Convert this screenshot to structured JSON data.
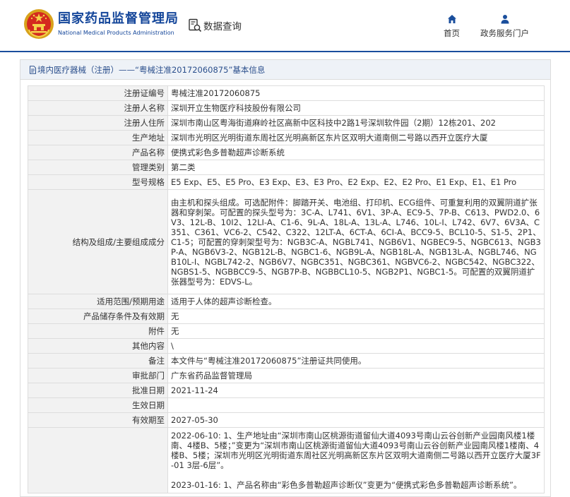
{
  "header": {
    "brand_cn": "国家药品监督管理局",
    "brand_en": "National Medical Products Administration",
    "data_query": "数据查询",
    "nav_home": "首页",
    "nav_services": "政务服务门户"
  },
  "panel": {
    "title": "境内医疗器械（注册）——“粤械注准20172060875”基本信息"
  },
  "rows": [
    {
      "label": "注册证编号",
      "value": "粤械注准20172060875"
    },
    {
      "label": "注册人名称",
      "value": "深圳开立生物医疗科技股份有限公司"
    },
    {
      "label": "注册人住所",
      "value": "深圳市南山区粤海街道麻岭社区高新中区科技中2路1号深圳软件园（2期）12栋201、202"
    },
    {
      "label": "生产地址",
      "value": "深圳市光明区光明街道东周社区光明高新区东片区双明大道南侧二号路以西开立医疗大厦"
    },
    {
      "label": "产品名称",
      "value": "便携式彩色多普勒超声诊断系统"
    },
    {
      "label": "管理类别",
      "value": "第二类"
    },
    {
      "label": "型号规格",
      "value": "E5 Exp、E5、E5 Pro、E3 Exp、E3、E3 Pro、E2 Exp、E2、E2 Pro、E1 Exp、E1、E1 Pro"
    },
    {
      "label": "结构及组成/主要组成成分",
      "value": "由主机和探头组成。可选配附件：脚踏开关、电池组、打印机、ECG组件、可重复利用的双翼阴道扩张器和穿刺架。可配置的探头型号为：3C-A、L741、6V1、3P-A、EC9-5、7P-B、C613、PWD2.0、6V3、12L-B、10I2、12LI-A、C1-6、9L-A、18L-A、13L-A、L746、10L-I、L742、6V7、6V3A、C351、C361、VC6-2、C542、C322、12LT-A、6CT-A、6CI-A、BCC9-5、BCL10-5、S1-5、2P1、C1-5；可配置的穿刺架型号为：NGB3C-A、NGBL741、NGB6V1、NGBEC9-5、NGBC613、NGB3P-A、NGB6V3-2、NGB12L-B、NGBC1-6、NGB9L-A、NGB18L-A、NGB13L-A、NGBL746、NGB10L-I、NGBL742-2、NGB6V7、NGBC351、NGBC361、NGBVC6-2、NGBC542、NGBC322、NGBS1-5、NGBBCC9-5、NGB7P-B、NGBBCL10-5、NGB2P1、NGBC1-5。可配置的双翼阴道扩张器型号为：EDVS-L。"
    },
    {
      "label": "适用范围/预期用途",
      "value": "适用于人体的超声诊断检查。"
    },
    {
      "label": "产品储存条件及有效期",
      "value": "无"
    },
    {
      "label": "附件",
      "value": "无"
    },
    {
      "label": "其他内容",
      "value": "\\"
    },
    {
      "label": "备注",
      "value": "本文件与“粤械注准20172060875”注册证共同使用。"
    },
    {
      "label": "审批部门",
      "value": "广东省药品监督管理局"
    },
    {
      "label": "批准日期",
      "value": "2021-11-24"
    },
    {
      "label": "生效日期",
      "value": ""
    },
    {
      "label": "有效期至",
      "value": "2027-05-30"
    },
    {
      "label": "",
      "value": ""
    }
  ],
  "changes": [
    "2022-06-10: 1、生产地址由“深圳市南山区桃源街道留仙大道4093号南山云谷创新产业园南风楼1楼南、4楼B、5楼；”变更为“深圳市南山区桃源街道留仙大道4093号南山云谷创新产业园南风楼1楼南、4楼B、5楼；深圳市光明区光明街道东周社区光明高新区东片区双明大道南侧二号路以西开立医疗大厦3F-01 3层-6层”。",
    "2023-01-16: 1、产品名称由“彩色多普勒超声诊断仪”变更为“便携式彩色多普勒超声诊断系统”。"
  ],
  "colors": {
    "brand_blue": "#14469a",
    "nav_icon": "#1a4e9c",
    "label_bg": "#f2f2f2",
    "panel_head_bg": "#eef2f7"
  },
  "icons": {
    "logo": "emblem-icon",
    "data_query": "document-search-icon",
    "home": "home-icon",
    "services": "user-icon",
    "panel_head": "document-icon"
  }
}
